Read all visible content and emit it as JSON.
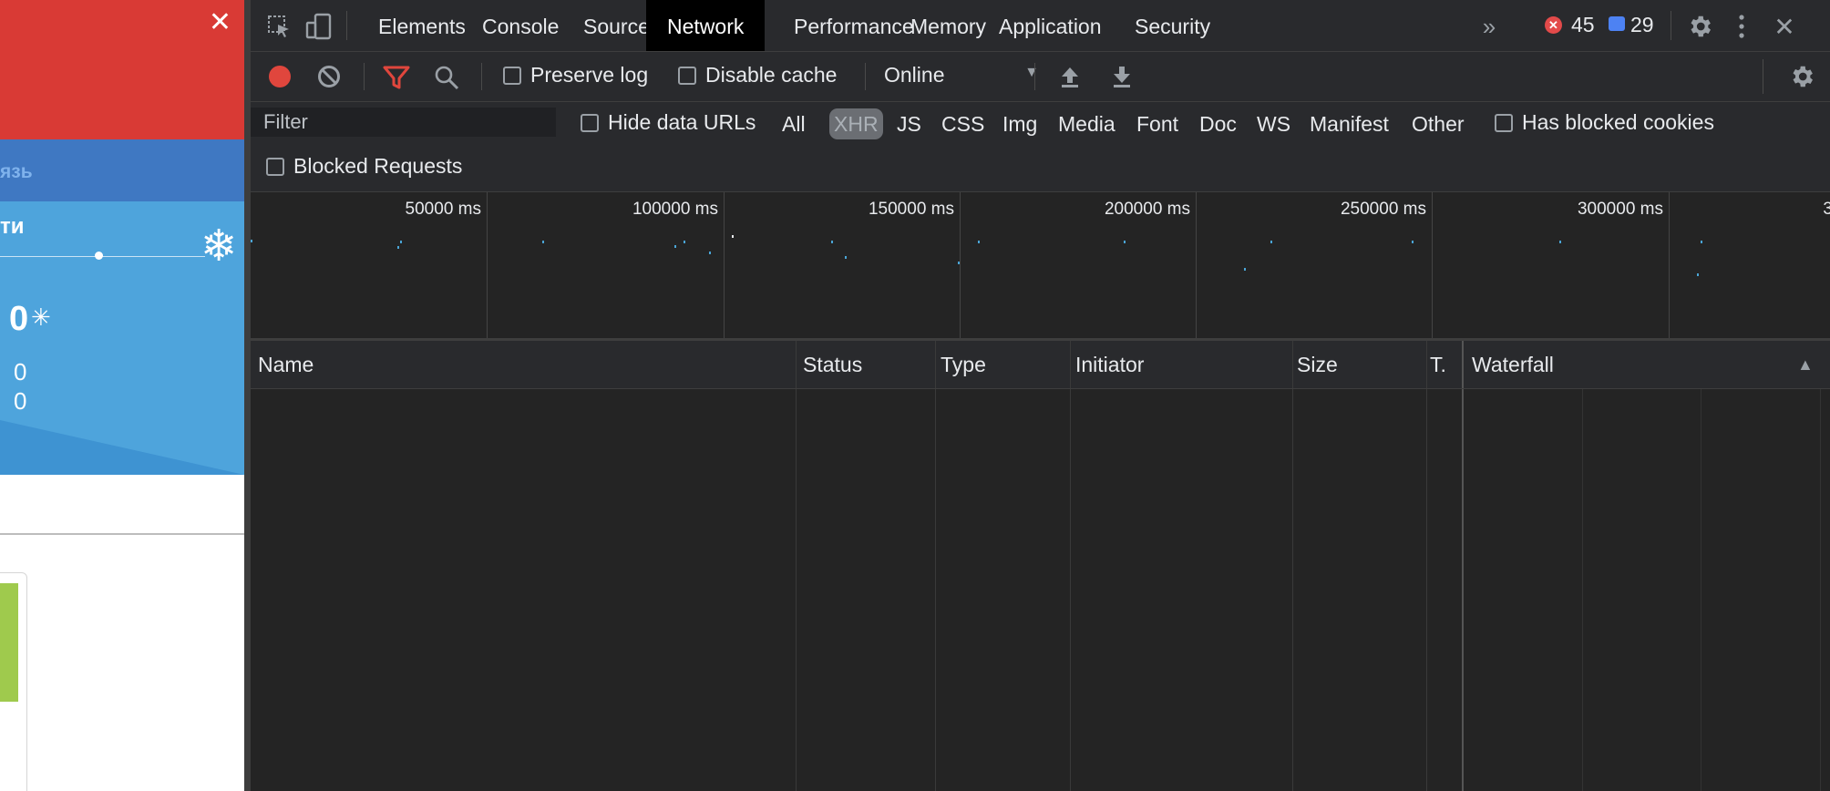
{
  "page": {
    "strip_text": "язь",
    "weather_title": "ти",
    "weather_big": "0",
    "weather_v1": "0",
    "weather_v2": "0"
  },
  "tabs": [
    {
      "label": "Elements"
    },
    {
      "label": "Console"
    },
    {
      "label": "Sources"
    },
    {
      "label": "Network"
    },
    {
      "label": "Performance"
    },
    {
      "label": "Memory"
    },
    {
      "label": "Application"
    },
    {
      "label": "Security"
    }
  ],
  "active_tab": "Network",
  "status": {
    "errors": "45",
    "messages": "29"
  },
  "toolbar": {
    "preserve_log": "Preserve log",
    "disable_cache": "Disable cache",
    "throttling": "Online"
  },
  "filter": {
    "placeholder": "Filter",
    "hide_data_urls": "Hide data URLs",
    "types": [
      "All",
      "XHR",
      "JS",
      "CSS",
      "Img",
      "Media",
      "Font",
      "Doc",
      "WS",
      "Manifest",
      "Other"
    ],
    "active_type": "XHR",
    "has_blocked_cookies": "Has blocked cookies",
    "blocked_requests": "Blocked Requests"
  },
  "overview": {
    "ticks": [
      "50000 ms",
      "100000 ms",
      "150000 ms",
      "200000 ms",
      "250000 ms",
      "300000 ms",
      "3"
    ]
  },
  "table": {
    "columns": [
      "Name",
      "Status",
      "Type",
      "Initiator",
      "Size",
      "T.",
      "Waterfall"
    ],
    "sort_indicator": "▲"
  },
  "colors": {
    "record": "#e0463d",
    "filter_active": "#e0463d",
    "error_badge": "#e34a4a",
    "message_badge": "#4d82f3",
    "timeline_dot": "#4aa5d6"
  }
}
